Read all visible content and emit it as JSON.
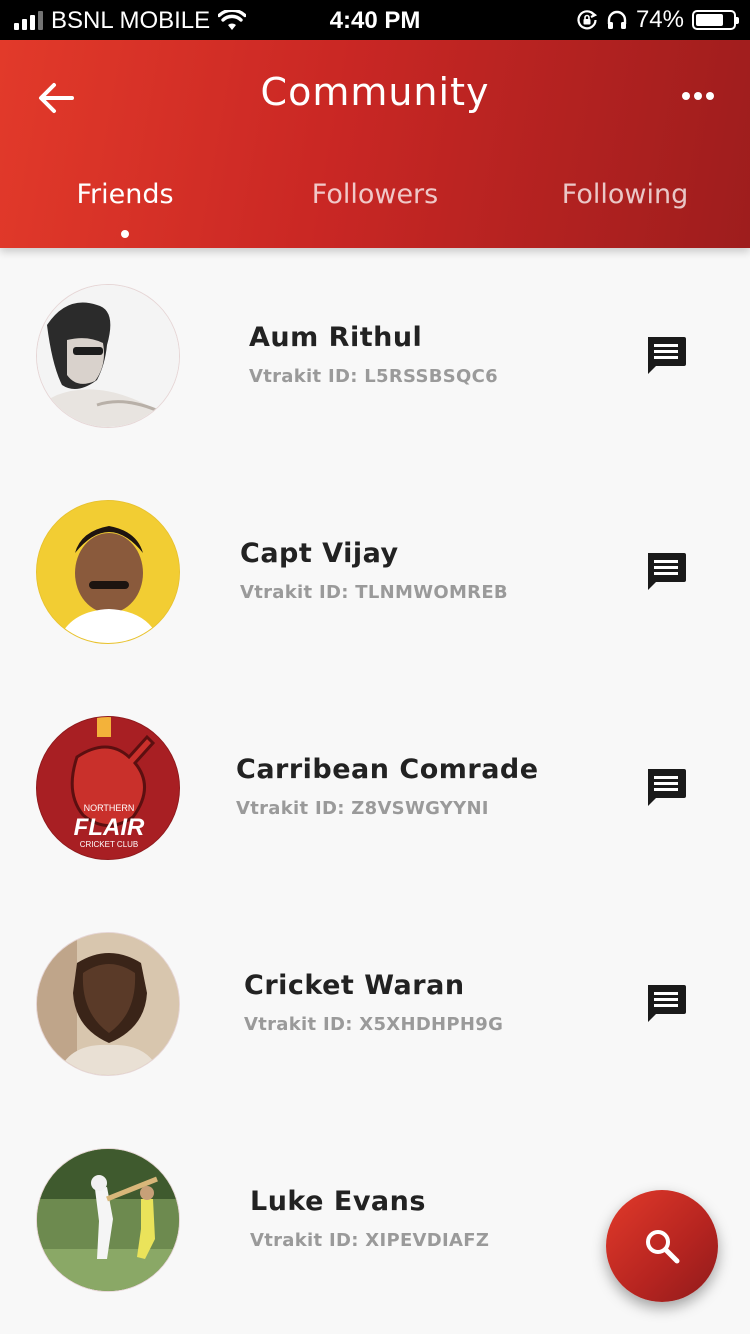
{
  "status_bar": {
    "carrier": "BSNL MOBILE",
    "time": "4:40 PM",
    "battery": "74%",
    "battery_level": 0.74
  },
  "header": {
    "title": "Community",
    "back_icon": "arrow-left-icon",
    "more_icon": "more-horizontal-icon",
    "tabs": [
      {
        "label": "Friends",
        "active": true
      },
      {
        "label": "Followers",
        "active": false
      },
      {
        "label": "Following",
        "active": false
      }
    ]
  },
  "friends": [
    {
      "name": "Aum Rithul",
      "id_text": "Vtrakit ID: L5RSSBSQC6"
    },
    {
      "name": "Capt Vijay",
      "id_text": "Vtrakit ID: TLNMWOMREB"
    },
    {
      "name": "Carribean Comrade",
      "id_text": "Vtrakit ID: Z8VSWGYYNI"
    },
    {
      "name": "Cricket Waran",
      "id_text": "Vtrakit ID: X5XHDHPH9G"
    },
    {
      "name": "Luke Evans",
      "id_text": "Vtrakit ID: XIPEVDIAFZ"
    }
  ],
  "logo_text": {
    "line1": "NORTHERN",
    "line2": "FLAIR",
    "line3": "CRICKET CLUB"
  },
  "icons": {
    "chat": "chat-icon",
    "search": "search-icon"
  },
  "colors": {
    "header_start": "#e23a2a",
    "header_end": "#9e1d1d",
    "background": "#f8f8f8"
  }
}
